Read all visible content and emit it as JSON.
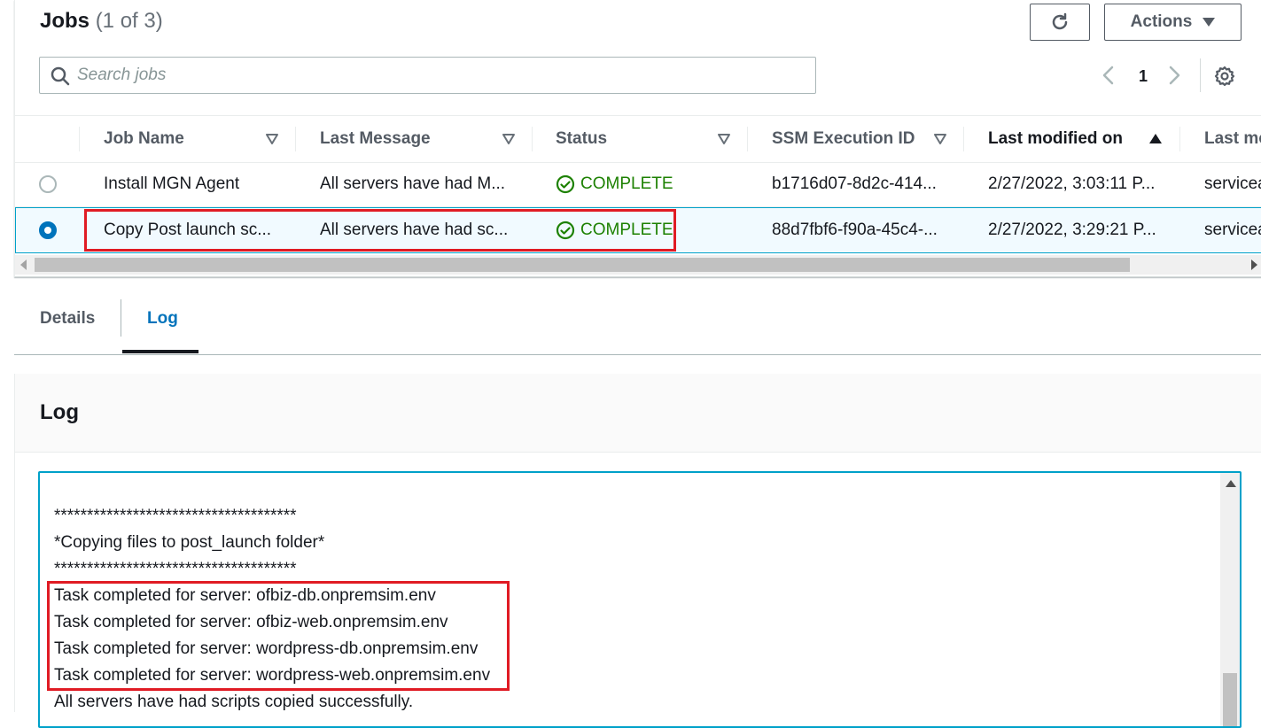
{
  "jobs": {
    "title": "Jobs",
    "count": "(1 of 3)",
    "actions_label": "Actions",
    "search_placeholder": "Search jobs",
    "page_number": "1"
  },
  "table": {
    "columns": [
      "Job Name",
      "Last Message",
      "Status",
      "SSM Execution ID",
      "Last modified on",
      "Last mo"
    ],
    "rows": [
      {
        "job_name": "Install MGN Agent",
        "last_message": "All servers have had M...",
        "status": "COMPLETE",
        "ssm_id": "b1716d07-8d2c-414...",
        "last_modified": "2/27/2022, 3:03:11 P...",
        "last_mod_by": "servicea",
        "selected": false
      },
      {
        "job_name": "Copy Post launch sc...",
        "last_message": "All servers have had sc...",
        "status": "COMPLETE",
        "ssm_id": "88d7fbf6-f90a-45c4-...",
        "last_modified": "2/27/2022, 3:29:21 P...",
        "last_mod_by": "servicea",
        "selected": true
      }
    ]
  },
  "tabs": [
    "Details",
    "Log"
  ],
  "log": {
    "title": "Log",
    "lines": [
      "*************************************",
      "*Copying files to post_launch folder*",
      "*************************************",
      "Task completed for server: ofbiz-db.onpremsim.env",
      "Task completed for server: ofbiz-web.onpremsim.env",
      "Task completed for server: wordpress-db.onpremsim.env",
      "Task completed for server: wordpress-web.onpremsim.env",
      "All servers have had scripts copied successfully."
    ]
  },
  "colors": {
    "accent": "#0073bb",
    "success": "#1d8102",
    "highlight": "#e01b24"
  }
}
